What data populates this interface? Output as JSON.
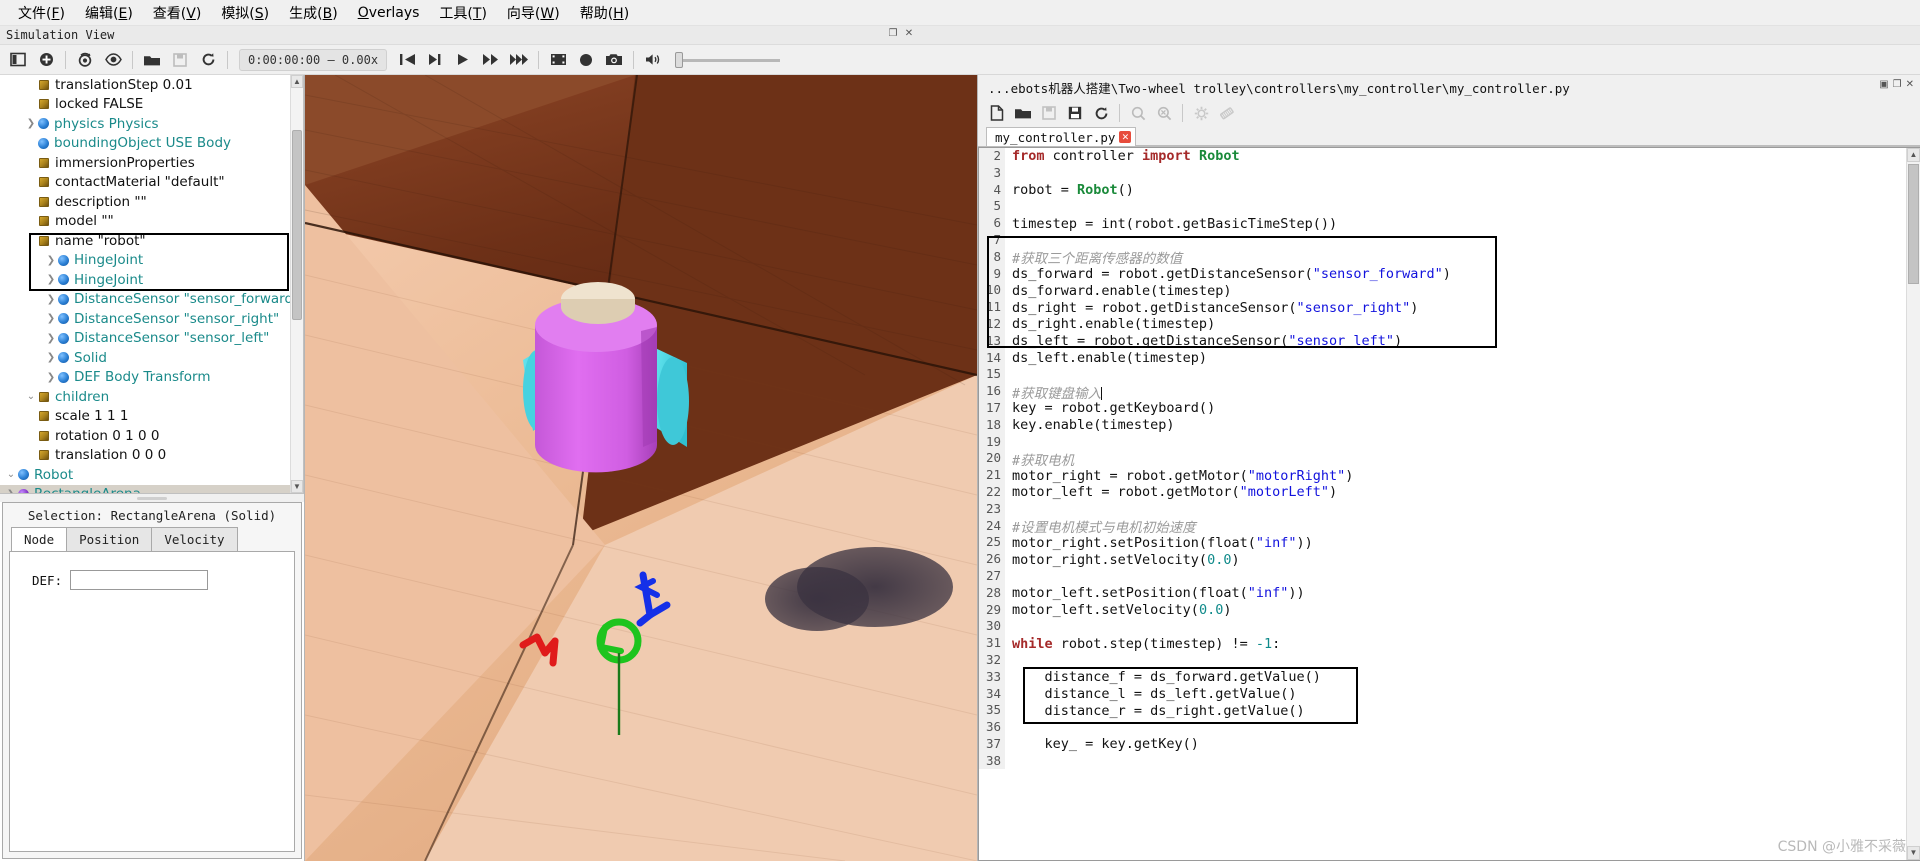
{
  "menubar": {
    "items": [
      {
        "label": "文件(F)"
      },
      {
        "label": "编辑(E)"
      },
      {
        "label": "查看(V)"
      },
      {
        "label": "模拟(S)"
      },
      {
        "label": "生成(B)"
      },
      {
        "label": "Overlays"
      },
      {
        "label": "工具(T)"
      },
      {
        "label": "向导(W)"
      },
      {
        "label": "帮助(H)"
      }
    ]
  },
  "simview": {
    "title": "Simulation View",
    "restore_glyph": "❐",
    "close_glyph": "✕",
    "toolbar": {
      "time": "0:00:00:00 —  0.00x",
      "buttons": [
        {
          "name": "toggle-sidebar",
          "glyph": "sidebar"
        },
        {
          "name": "add-node",
          "glyph": "plus-circle"
        },
        {
          "name": "view-point",
          "glyph": "camera-rotate"
        },
        {
          "name": "eye",
          "glyph": "eye"
        },
        {
          "name": "open-world",
          "glyph": "folder"
        },
        {
          "name": "save-world",
          "glyph": "floppy"
        },
        {
          "name": "reload-world",
          "glyph": "reload"
        },
        {
          "name": "step-back",
          "glyph": "rewind"
        },
        {
          "name": "step",
          "glyph": "step-forward"
        },
        {
          "name": "play",
          "glyph": "play"
        },
        {
          "name": "fast",
          "glyph": "fast-forward"
        },
        {
          "name": "run",
          "glyph": "run-forward"
        },
        {
          "name": "movie",
          "glyph": "film"
        },
        {
          "name": "record",
          "glyph": "record"
        },
        {
          "name": "screenshot",
          "glyph": "camera"
        },
        {
          "name": "sound",
          "glyph": "speaker"
        }
      ]
    }
  },
  "scene_tree": {
    "rows": [
      {
        "indent": 0,
        "arrow": "right",
        "icon": "node-purple",
        "label": "RectangleArena",
        "style": "teal",
        "selected": true
      },
      {
        "indent": 0,
        "arrow": "down",
        "icon": "node-blue",
        "label": "Robot",
        "style": "teal",
        "selected": false
      },
      {
        "indent": 1,
        "arrow": "none",
        "icon": "field",
        "label": "translation 0 0 0",
        "style": "blk",
        "selected": false
      },
      {
        "indent": 1,
        "arrow": "none",
        "icon": "field",
        "label": "rotation 0 1 0 0",
        "style": "blk",
        "selected": false
      },
      {
        "indent": 1,
        "arrow": "none",
        "icon": "field",
        "label": "scale 1 1 1",
        "style": "blk",
        "selected": false
      },
      {
        "indent": 1,
        "arrow": "down",
        "icon": "field",
        "label": "children",
        "style": "teal",
        "selected": false
      },
      {
        "indent": 2,
        "arrow": "right",
        "icon": "node-blue",
        "label": "DEF Body Transform",
        "style": "teal",
        "selected": false
      },
      {
        "indent": 2,
        "arrow": "right",
        "icon": "node-blue",
        "label": "Solid",
        "style": "teal",
        "selected": false
      },
      {
        "indent": 2,
        "arrow": "right",
        "icon": "node-blue",
        "label": "DistanceSensor \"sensor_left\"",
        "style": "teal",
        "selected": false
      },
      {
        "indent": 2,
        "arrow": "right",
        "icon": "node-blue",
        "label": "DistanceSensor \"sensor_right\"",
        "style": "teal",
        "selected": false
      },
      {
        "indent": 2,
        "arrow": "right",
        "icon": "node-blue",
        "label": "DistanceSensor \"sensor_forward\"",
        "style": "teal",
        "selected": false
      },
      {
        "indent": 2,
        "arrow": "right",
        "icon": "node-blue",
        "label": "HingeJoint",
        "style": "teal",
        "selected": false
      },
      {
        "indent": 2,
        "arrow": "right",
        "icon": "node-blue",
        "label": "HingeJoint",
        "style": "teal",
        "selected": false
      },
      {
        "indent": 1,
        "arrow": "none",
        "icon": "field",
        "label": "name \"robot\"",
        "style": "blk",
        "selected": false
      },
      {
        "indent": 1,
        "arrow": "none",
        "icon": "field",
        "label": "model \"\"",
        "style": "blk",
        "selected": false
      },
      {
        "indent": 1,
        "arrow": "none",
        "icon": "field",
        "label": "description \"\"",
        "style": "blk",
        "selected": false
      },
      {
        "indent": 1,
        "arrow": "none",
        "icon": "field",
        "label": "contactMaterial \"default\"",
        "style": "blk",
        "selected": false
      },
      {
        "indent": 1,
        "arrow": "none",
        "icon": "field",
        "label": "immersionProperties",
        "style": "blk",
        "selected": false
      },
      {
        "indent": 1,
        "arrow": "none",
        "icon": "node-blue",
        "label": "boundingObject USE Body",
        "style": "teal",
        "selected": false
      },
      {
        "indent": 1,
        "arrow": "right",
        "icon": "node-blue",
        "label": "physics Physics",
        "style": "teal",
        "selected": false
      },
      {
        "indent": 1,
        "arrow": "none",
        "icon": "field",
        "label": "locked FALSE",
        "style": "blk",
        "selected": false
      },
      {
        "indent": 1,
        "arrow": "none",
        "icon": "field",
        "label": "translationStep 0.01",
        "style": "blk",
        "selected": false
      }
    ]
  },
  "selection": {
    "header": "Selection: RectangleArena (Solid)",
    "tabs": [
      {
        "label": "Node",
        "active": true
      },
      {
        "label": "Position",
        "active": false
      },
      {
        "label": "Velocity",
        "active": false
      }
    ],
    "def_label": "DEF:",
    "def_value": ""
  },
  "code_editor": {
    "window_path": "...ebots机器人搭建\\Two-wheel trolley\\controllers\\my_controller\\my_controller.py",
    "window_buttons": [
      "▣",
      "❐",
      "✕"
    ],
    "toolbar_buttons": [
      {
        "name": "new-file",
        "glyph": "file"
      },
      {
        "name": "open-file",
        "glyph": "folder"
      },
      {
        "name": "save-file",
        "glyph": "floppy-disabled"
      },
      {
        "name": "save-all",
        "glyph": "floppy"
      },
      {
        "name": "reset-file",
        "glyph": "reload"
      },
      {
        "name": "find",
        "glyph": "magnifier"
      },
      {
        "name": "find-replace",
        "glyph": "magnifier-x"
      },
      {
        "name": "settings",
        "glyph": "gear"
      },
      {
        "name": "clean",
        "glyph": "eraser"
      }
    ],
    "tab": {
      "name": "my_controller.py",
      "close": "✕"
    },
    "lines": [
      {
        "n": 2,
        "tokens": [
          {
            "t": "from ",
            "c": "k"
          },
          {
            "t": "controller ",
            "c": "fn"
          },
          {
            "t": "import ",
            "c": "k"
          },
          {
            "t": "Robot",
            "c": "cls"
          }
        ]
      },
      {
        "n": 3,
        "tokens": []
      },
      {
        "n": 4,
        "tokens": [
          {
            "t": "robot = ",
            "c": "fn"
          },
          {
            "t": "Robot",
            "c": "cls"
          },
          {
            "t": "()",
            "c": "fn"
          }
        ]
      },
      {
        "n": 5,
        "tokens": []
      },
      {
        "n": 6,
        "tokens": [
          {
            "t": "timestep = int(robot.getBasicTimeStep())",
            "c": "fn"
          }
        ]
      },
      {
        "n": 7,
        "tokens": []
      },
      {
        "n": 8,
        "tokens": [
          {
            "t": "#获取三个距离传感器的数值",
            "c": "cmt"
          }
        ]
      },
      {
        "n": 9,
        "tokens": [
          {
            "t": "ds_forward = robot.getDistanceSensor(",
            "c": "fn"
          },
          {
            "t": "\"sensor_forward\"",
            "c": "str"
          },
          {
            "t": ")",
            "c": "fn"
          }
        ]
      },
      {
        "n": 10,
        "tokens": [
          {
            "t": "ds_forward.enable(timestep)",
            "c": "fn"
          }
        ]
      },
      {
        "n": 11,
        "tokens": [
          {
            "t": "ds_right = robot.getDistanceSensor(",
            "c": "fn"
          },
          {
            "t": "\"sensor_right\"",
            "c": "str"
          },
          {
            "t": ")",
            "c": "fn"
          }
        ]
      },
      {
        "n": 12,
        "tokens": [
          {
            "t": "ds_right.enable(timestep)",
            "c": "fn"
          }
        ]
      },
      {
        "n": 13,
        "tokens": [
          {
            "t": "ds_left = robot.getDistanceSensor(",
            "c": "fn"
          },
          {
            "t": "\"sensor_left\"",
            "c": "str"
          },
          {
            "t": ")",
            "c": "fn"
          }
        ]
      },
      {
        "n": 14,
        "tokens": [
          {
            "t": "ds_left.enable(timestep)",
            "c": "fn"
          }
        ]
      },
      {
        "n": 15,
        "tokens": []
      },
      {
        "n": 16,
        "tokens": [
          {
            "t": "#获取键盘输入",
            "c": "cmt"
          },
          {
            "t": "|",
            "c": "caret"
          }
        ]
      },
      {
        "n": 17,
        "tokens": [
          {
            "t": "key = robot.getKeyboard()",
            "c": "fn"
          }
        ]
      },
      {
        "n": 18,
        "tokens": [
          {
            "t": "key.enable(timestep)",
            "c": "fn"
          }
        ]
      },
      {
        "n": 19,
        "tokens": []
      },
      {
        "n": 20,
        "tokens": [
          {
            "t": "#获取电机",
            "c": "cmt"
          }
        ]
      },
      {
        "n": 21,
        "tokens": [
          {
            "t": "motor_right = robot.getMotor(",
            "c": "fn"
          },
          {
            "t": "\"motorRight\"",
            "c": "str"
          },
          {
            "t": ")",
            "c": "fn"
          }
        ]
      },
      {
        "n": 22,
        "tokens": [
          {
            "t": "motor_left = robot.getMotor(",
            "c": "fn"
          },
          {
            "t": "\"motorLeft\"",
            "c": "str"
          },
          {
            "t": ")",
            "c": "fn"
          }
        ]
      },
      {
        "n": 23,
        "tokens": []
      },
      {
        "n": 24,
        "tokens": [
          {
            "t": "#设置电机模式与电机初始速度",
            "c": "cmt"
          }
        ]
      },
      {
        "n": 25,
        "tokens": [
          {
            "t": "motor_right.setPosition(float(",
            "c": "fn"
          },
          {
            "t": "\"inf\"",
            "c": "str"
          },
          {
            "t": "))",
            "c": "fn"
          }
        ]
      },
      {
        "n": 26,
        "tokens": [
          {
            "t": "motor_right.setVelocity(",
            "c": "fn"
          },
          {
            "t": "0.0",
            "c": "num"
          },
          {
            "t": ")",
            "c": "fn"
          }
        ]
      },
      {
        "n": 27,
        "tokens": []
      },
      {
        "n": 28,
        "tokens": [
          {
            "t": "motor_left.setPosition(float(",
            "c": "fn"
          },
          {
            "t": "\"inf\"",
            "c": "str"
          },
          {
            "t": "))",
            "c": "fn"
          }
        ]
      },
      {
        "n": 29,
        "tokens": [
          {
            "t": "motor_left.setVelocity(",
            "c": "fn"
          },
          {
            "t": "0.0",
            "c": "num"
          },
          {
            "t": ")",
            "c": "fn"
          }
        ]
      },
      {
        "n": 30,
        "tokens": []
      },
      {
        "n": 31,
        "tokens": [
          {
            "t": "while ",
            "c": "k"
          },
          {
            "t": "robot.step(timestep) != ",
            "c": "fn"
          },
          {
            "t": "-1",
            "c": "num"
          },
          {
            "t": ":",
            "c": "fn"
          }
        ]
      },
      {
        "n": 32,
        "tokens": []
      },
      {
        "n": 33,
        "tokens": [
          {
            "t": "    distance_f = ds_forward.getValue()",
            "c": "fn"
          }
        ]
      },
      {
        "n": 34,
        "tokens": [
          {
            "t": "    distance_l = ds_left.getValue()",
            "c": "fn"
          }
        ]
      },
      {
        "n": 35,
        "tokens": [
          {
            "t": "    distance_r = ds_right.getValue()",
            "c": "fn"
          }
        ]
      },
      {
        "n": 36,
        "tokens": []
      },
      {
        "n": 37,
        "tokens": [
          {
            "t": "    key_ = key.getKey()",
            "c": "fn"
          }
        ]
      },
      {
        "n": 38,
        "tokens": []
      }
    ]
  },
  "watermark": "CSDN @小雅不采薇",
  "colors": {
    "accent_teal": "#1a8a8a",
    "node_blue": "#2a7fd4",
    "node_purple": "#7d2fbf",
    "string_blue": "#1212dd",
    "keyword_red": "#a52a2a",
    "comment_gray": "#9a9a9a",
    "number_teal": "#0f8a8a",
    "selection_bg": "#d6d1c8"
  }
}
